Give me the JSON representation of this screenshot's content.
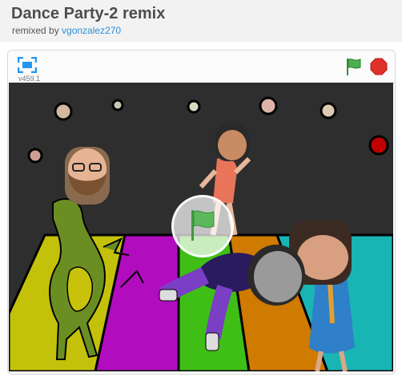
{
  "project": {
    "title": "Dance Party-2 remix",
    "remixed_prefix": "remixed by",
    "author": "vgonzalez270"
  },
  "player": {
    "version": "v459.1",
    "fullscreen_icon": "fullscreen-icon",
    "green_flag_icon": "green-flag-icon",
    "stop_icon": "stop-sign-icon",
    "colors": {
      "flag_green": "#4caf50",
      "stop_red": "#e0302b",
      "fullscreen_blue": "#2196f3"
    }
  },
  "stage": {
    "background": "#2e2e2e",
    "floor_stripes": [
      "#c4c10a",
      "#b20cbf",
      "#3fbf16",
      "#cf7a00",
      "#19b5b5"
    ],
    "overlay_icon": "green-flag-icon"
  }
}
